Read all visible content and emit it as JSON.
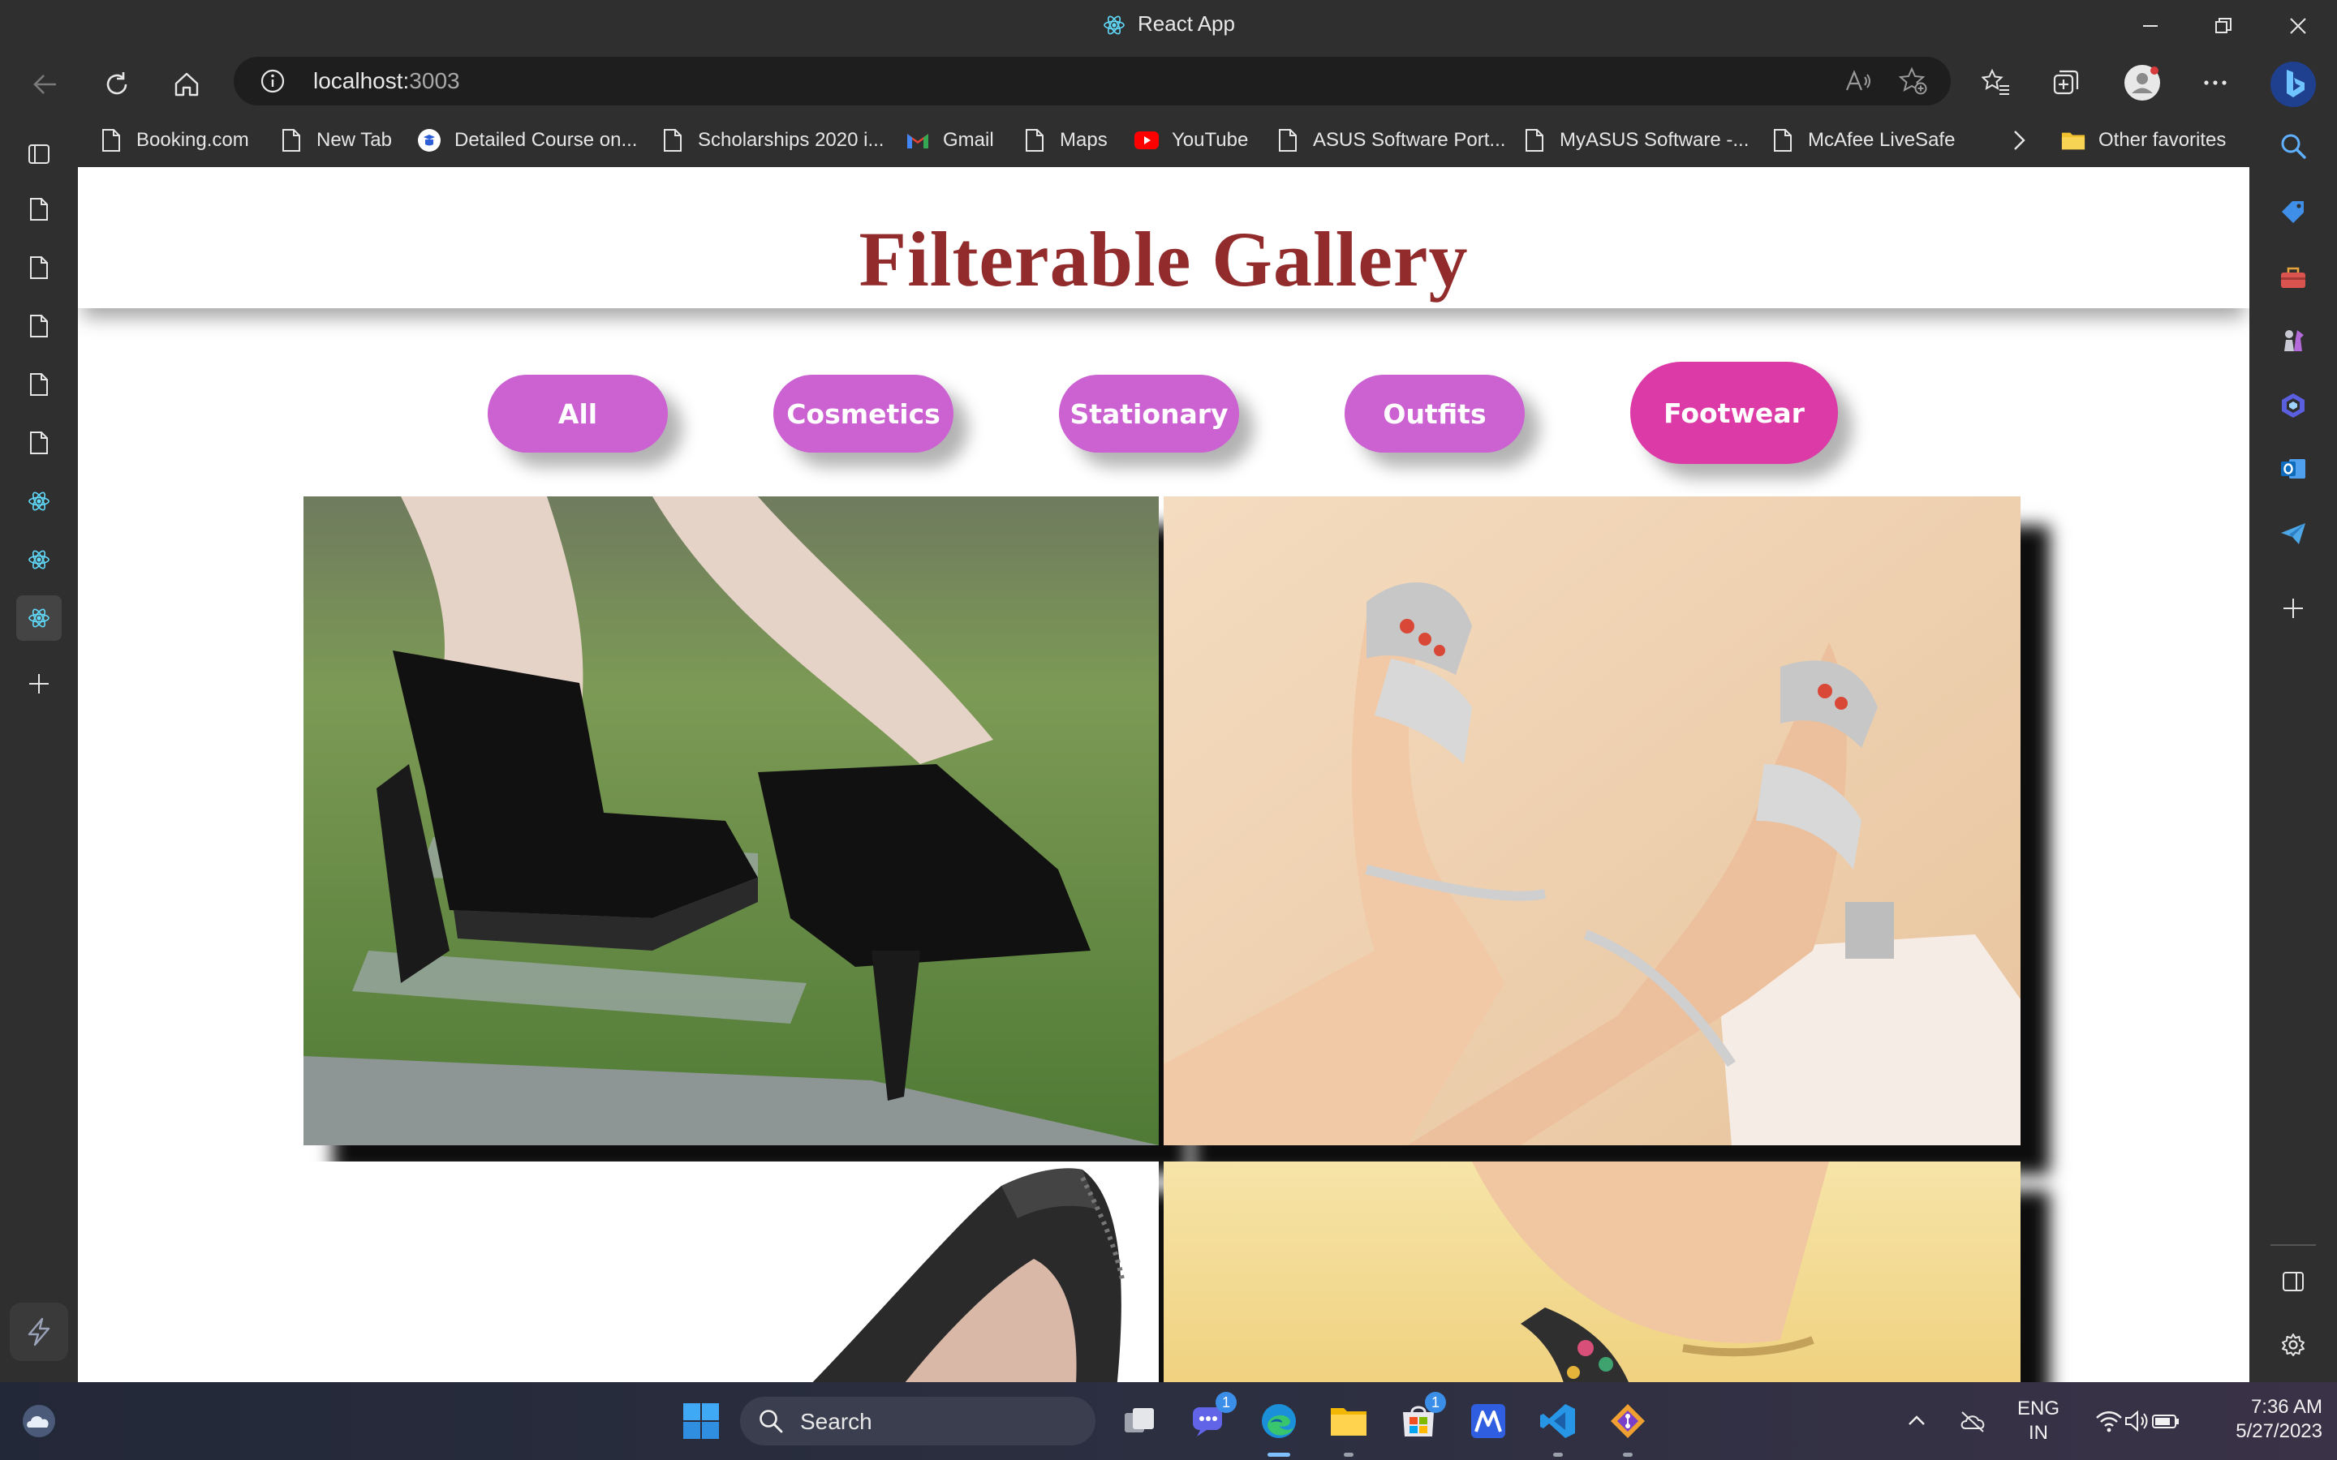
{
  "window": {
    "title": "React App"
  },
  "address_bar": {
    "host": "localhost:",
    "port": "3003"
  },
  "favorites": [
    {
      "label": "Booking.com",
      "icon": "page-icon"
    },
    {
      "label": "New Tab",
      "icon": "page-icon"
    },
    {
      "label": "Detailed Course on...",
      "icon": "course-icon"
    },
    {
      "label": "Scholarships 2020 i...",
      "icon": "page-icon"
    },
    {
      "label": "Gmail",
      "icon": "gmail-icon"
    },
    {
      "label": "Maps",
      "icon": "page-icon"
    },
    {
      "label": "YouTube",
      "icon": "youtube-icon"
    },
    {
      "label": "ASUS Software Port...",
      "icon": "page-icon"
    },
    {
      "label": "MyASUS Software -...",
      "icon": "page-icon"
    },
    {
      "label": "McAfee LiveSafe",
      "icon": "page-icon"
    }
  ],
  "other_favorites": "Other favorites",
  "page": {
    "heading": "Filterable Gallery",
    "filters": [
      "All",
      "Cosmetics",
      "Stationary",
      "Outfits",
      "Footwear"
    ],
    "active_filter": "Footwear",
    "images": [
      {
        "subject": "black platform heels on grass",
        "colors": [
          "#3f6a32",
          "#1a1a1a"
        ]
      },
      {
        "subject": "silver strappy sandals",
        "colors": [
          "#f2d4b4",
          "#c9c9c9"
        ]
      },
      {
        "subject": "black patent pump",
        "colors": [
          "#ffffff",
          "#2a2a2a"
        ]
      },
      {
        "subject": "embellished sandal",
        "colors": [
          "#f3dc9a",
          "#e8c877"
        ]
      }
    ]
  },
  "taskbar": {
    "search_label": "Search",
    "chat_badge": "1",
    "store_badge": "1",
    "language": "ENG",
    "region": "IN",
    "time": "7:36 AM",
    "date": "5/27/2023"
  },
  "colors": {
    "heading": "#922b2b",
    "filter_button": "#cc62d2",
    "filter_button_active": "#dc3aa6"
  }
}
